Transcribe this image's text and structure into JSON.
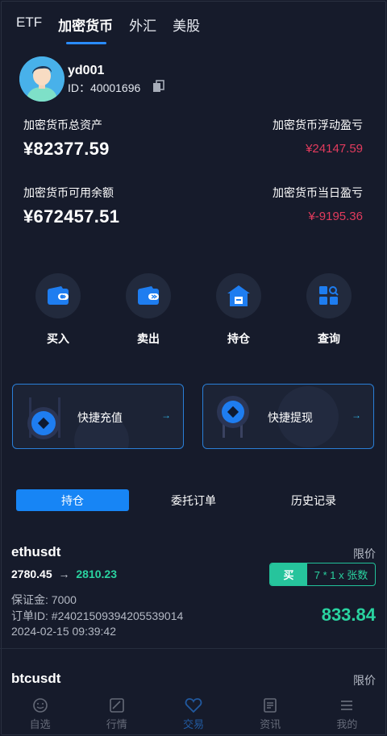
{
  "top_tabs": [
    "ETF",
    "加密货币",
    "外汇",
    "美股"
  ],
  "top_tabs_active": 1,
  "user": {
    "name": "yd001",
    "id_text": "ID：40001696"
  },
  "stats": {
    "total_assets_label": "加密货币总资产",
    "total_assets_value": "¥82377.59",
    "floating_pnl_label": "加密货币浮动盈亏",
    "floating_pnl_value": "¥24147.59",
    "available_label": "加密货币可用余额",
    "available_value": "¥672457.51",
    "daily_pnl_label": "加密货币当日盈亏",
    "daily_pnl_value": "¥-9195.36"
  },
  "actions": [
    {
      "label": "买入",
      "icon": "wallet-in-icon"
    },
    {
      "label": "卖出",
      "icon": "wallet-out-icon"
    },
    {
      "label": "持仓",
      "icon": "warehouse-icon"
    },
    {
      "label": "查询",
      "icon": "grid-search-icon"
    }
  ],
  "quick": {
    "deposit": "快捷充值",
    "withdraw": "快捷提现",
    "arrow": "→"
  },
  "segments": [
    "持仓",
    "委托订单",
    "历史记录"
  ],
  "order": {
    "symbol": "ethusdt",
    "type": "限价",
    "open_price": "2780.45",
    "arrow": "→",
    "current_price": "2810.23",
    "side": "买",
    "qty": "7 * 1 x 张数",
    "margin": "保证金: 7000",
    "order_id": "订单ID: #24021509394205539014",
    "time": "2024-02-15 09:39:42",
    "pnl": "833.84"
  },
  "order2": {
    "symbol": "btcusdt",
    "type": "限价"
  },
  "bottom_nav": [
    "自选",
    "行情",
    "交易",
    "资讯",
    "我的"
  ],
  "bottom_nav_active": 2,
  "colors": {
    "accent": "#1785f5",
    "up": "#2ad3a0",
    "down": "#e23b5d",
    "bg": "#161b2b"
  }
}
